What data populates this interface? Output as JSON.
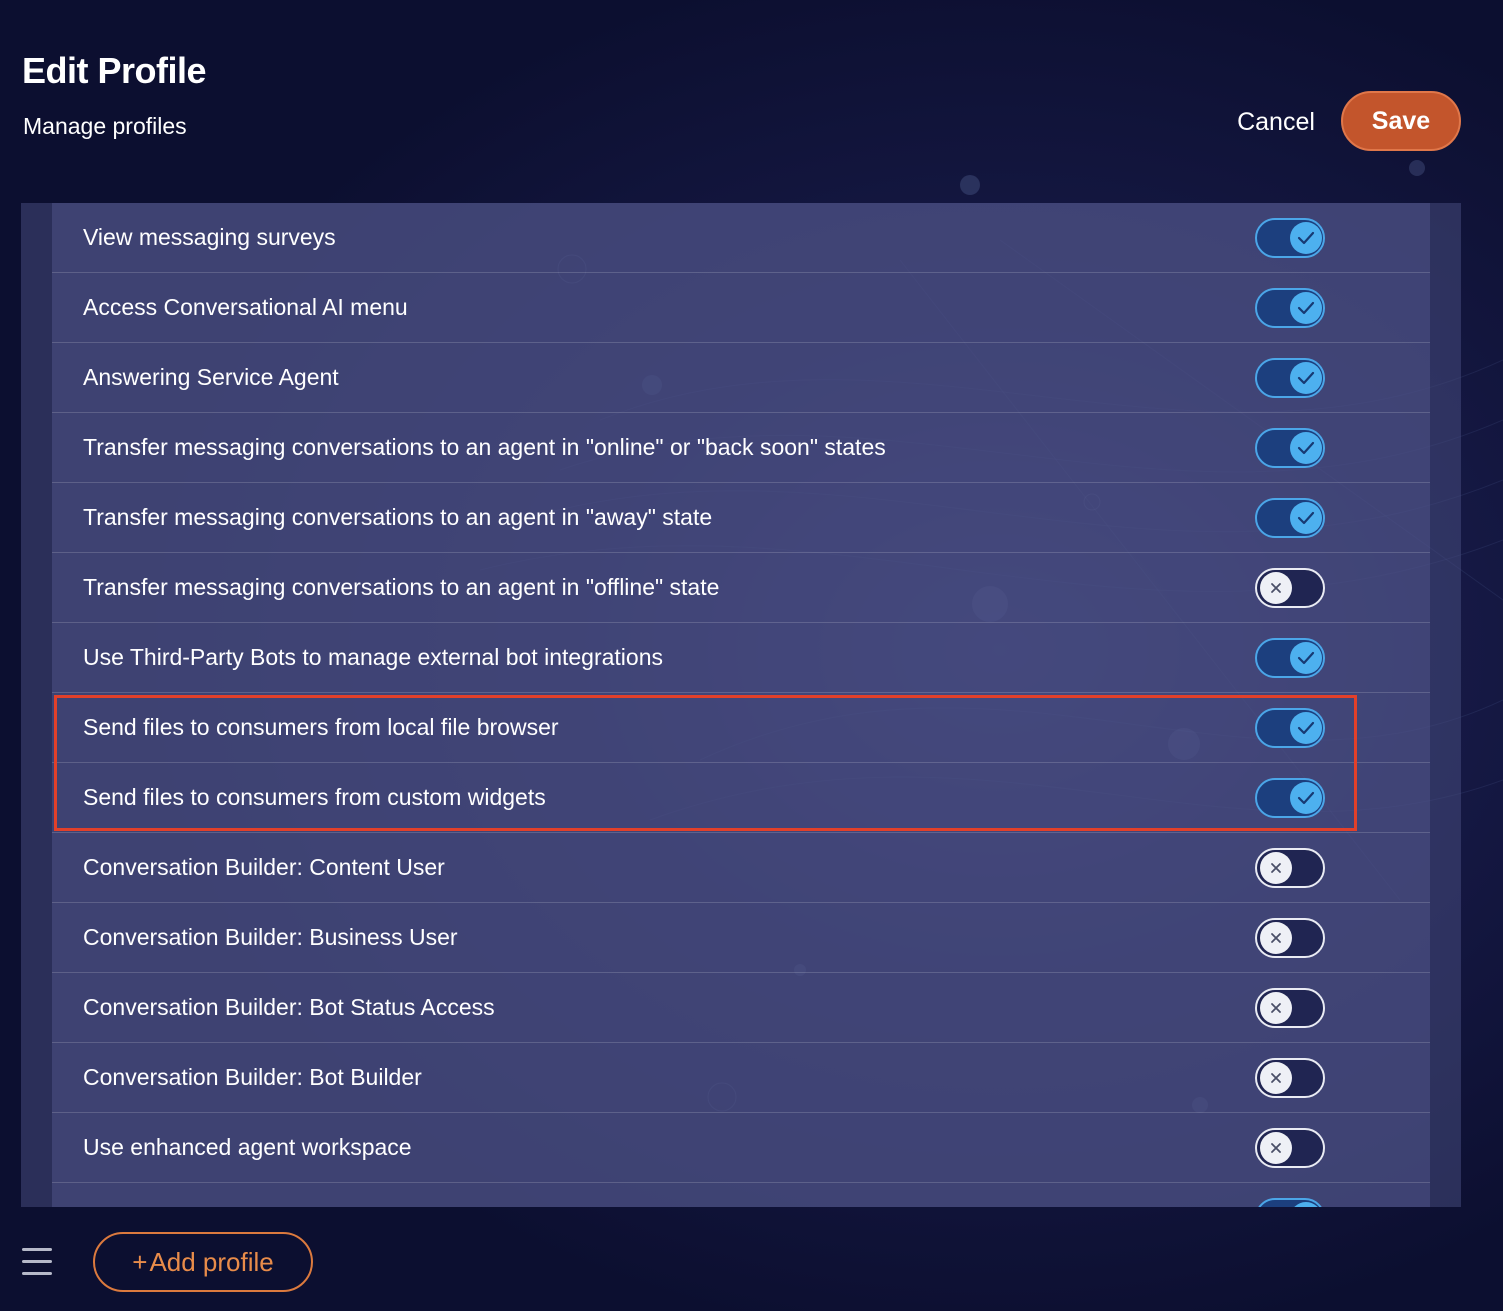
{
  "header": {
    "title": "Edit Profile",
    "subtitle": "Manage profiles",
    "cancel_label": "Cancel",
    "save_label": "Save"
  },
  "permissions": [
    {
      "label": "View messaging surveys",
      "enabled": true
    },
    {
      "label": "Access Conversational AI menu",
      "enabled": true
    },
    {
      "label": "Answering Service Agent",
      "enabled": true
    },
    {
      "label": "Transfer messaging conversations to an agent in \"online\" or \"back soon\" states",
      "enabled": true
    },
    {
      "label": "Transfer messaging conversations to an agent in \"away\" state",
      "enabled": true
    },
    {
      "label": "Transfer messaging conversations to an agent in \"offline\" state",
      "enabled": false
    },
    {
      "label": "Use Third-Party Bots to manage external bot integrations",
      "enabled": true
    },
    {
      "label": "Send files to consumers from local file browser",
      "enabled": true
    },
    {
      "label": "Send files to consumers from custom widgets",
      "enabled": true
    },
    {
      "label": "Conversation Builder: Content User",
      "enabled": false
    },
    {
      "label": "Conversation Builder: Business User",
      "enabled": false
    },
    {
      "label": "Conversation Builder: Bot Status Access",
      "enabled": false
    },
    {
      "label": "Conversation Builder: Bot Builder",
      "enabled": false
    },
    {
      "label": "Use enhanced agent workspace",
      "enabled": false
    },
    {
      "label": "",
      "enabled": true
    }
  ],
  "footer": {
    "add_profile_plus": "+",
    "add_profile_label": "Add profile"
  },
  "colors": {
    "accent": "#c3552c",
    "toggle_on": "#4db0ef",
    "highlight": "#e2402a"
  }
}
